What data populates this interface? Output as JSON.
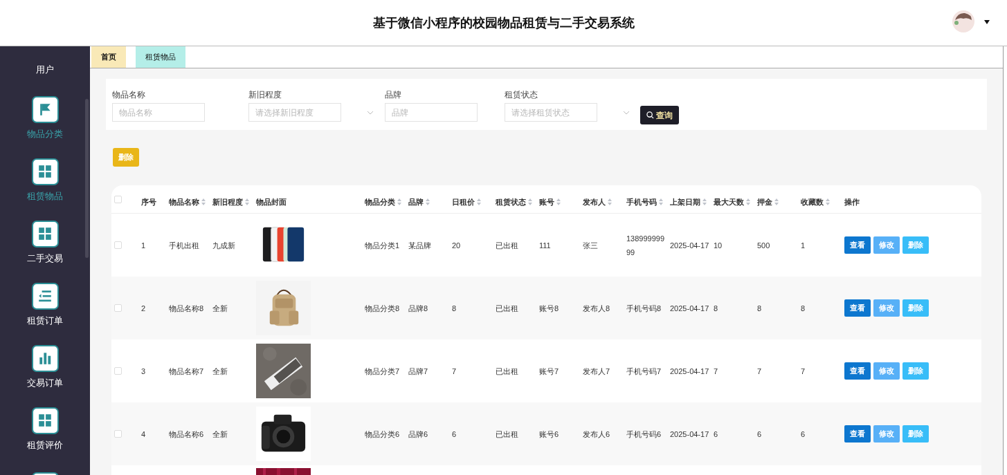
{
  "header": {
    "title": "基于微信小程序的校园物品租赁与二手交易系统"
  },
  "sidebar": {
    "role": "用户",
    "items": [
      {
        "label": "物品分类",
        "kind": "flag",
        "highlighted": true
      },
      {
        "label": "租赁物品",
        "kind": "grid",
        "highlighted": true
      },
      {
        "label": "二手交易",
        "kind": "grid",
        "highlighted": false
      },
      {
        "label": "租赁订单",
        "kind": "list",
        "highlighted": false
      },
      {
        "label": "交易订单",
        "kind": "bars",
        "highlighted": false
      },
      {
        "label": "租赁评价",
        "kind": "grid",
        "highlighted": false
      }
    ]
  },
  "tabs": [
    {
      "label": "首页",
      "selected": false,
      "color": "#f9e9b7"
    },
    {
      "label": "租赁物品",
      "selected": true,
      "color": "#b4eee8"
    }
  ],
  "filters": [
    {
      "label": "物品名称",
      "placeholder": "物品名称",
      "kind": "input"
    },
    {
      "label": "新旧程度",
      "placeholder": "请选择新旧程度",
      "kind": "select"
    },
    {
      "label": "品牌",
      "placeholder": "品牌",
      "kind": "input"
    },
    {
      "label": "租赁状态",
      "placeholder": "请选择租赁状态",
      "kind": "select"
    }
  ],
  "search_button": "查询",
  "delete_button": "删除",
  "table": {
    "select_all_checked": false,
    "columns": [
      {
        "label": "序号",
        "sortable": false
      },
      {
        "label": "物品名称",
        "sortable": true
      },
      {
        "label": "新旧程度",
        "sortable": true
      },
      {
        "label": "物品封面",
        "sortable": false
      },
      {
        "label": "物品分类",
        "sortable": true
      },
      {
        "label": "品牌",
        "sortable": true
      },
      {
        "label": "日租价",
        "sortable": true
      },
      {
        "label": "租赁状态",
        "sortable": true
      },
      {
        "label": "账号",
        "sortable": true
      },
      {
        "label": "发布人",
        "sortable": true
      },
      {
        "label": "手机号码",
        "sortable": true
      },
      {
        "label": "上架日期",
        "sortable": true
      },
      {
        "label": "最大天数",
        "sortable": true
      },
      {
        "label": "押金",
        "sortable": true
      },
      {
        "label": "收藏数",
        "sortable": true
      },
      {
        "label": "操作",
        "sortable": false
      }
    ],
    "rows": [
      {
        "checked": false,
        "cells": [
          "1",
          "手机出租",
          "九成新",
          {
            "kind": "picture"
          },
          "物品分类1",
          "某品牌",
          "20",
          "已出租",
          "111",
          "张三",
          "13899999999",
          "2025-04-17",
          "10",
          "500",
          "1"
        ],
        "actions": [
          {
            "label": "查看",
            "color": "#0d77cf"
          },
          {
            "label": "修改",
            "color": "#57b0f7"
          },
          {
            "label": "删除",
            "color": "#38bdf8"
          }
        ]
      },
      {
        "checked": false,
        "cells": [
          "2",
          "物品名称8",
          "全新",
          {
            "kind": "picture"
          },
          "物品分类8",
          "品牌8",
          "8",
          "已出租",
          "账号8",
          "发布人8",
          "手机号码8",
          "2025-04-17",
          "8",
          "8",
          "8"
        ],
        "actions": [
          {
            "label": "查看",
            "color": "#0d77cf"
          },
          {
            "label": "修改",
            "color": "#57b0f7"
          },
          {
            "label": "删除",
            "color": "#38bdf8"
          }
        ]
      },
      {
        "checked": false,
        "cells": [
          "3",
          "物品名称7",
          "全新",
          {
            "kind": "picture"
          },
          "物品分类7",
          "品牌7",
          "7",
          "已出租",
          "账号7",
          "发布人7",
          "手机号码7",
          "2025-04-17",
          "7",
          "7",
          "7"
        ],
        "actions": [
          {
            "label": "查看",
            "color": "#0d77cf"
          },
          {
            "label": "修改",
            "color": "#57b0f7"
          },
          {
            "label": "删除",
            "color": "#38bdf8"
          }
        ]
      },
      {
        "checked": false,
        "cells": [
          "4",
          "物品名称6",
          "全新",
          {
            "kind": "picture"
          },
          "物品分类6",
          "品牌6",
          "6",
          "已出租",
          "账号6",
          "发布人6",
          "手机号码6",
          "2025-04-17",
          "6",
          "6",
          "6"
        ],
        "actions": [
          {
            "label": "查看",
            "color": "#0d77cf"
          },
          {
            "label": "修改",
            "color": "#57b0f7"
          },
          {
            "label": "删除",
            "color": "#38bdf8"
          }
        ]
      }
    ],
    "cut_row": {
      "kind": "picture"
    }
  }
}
